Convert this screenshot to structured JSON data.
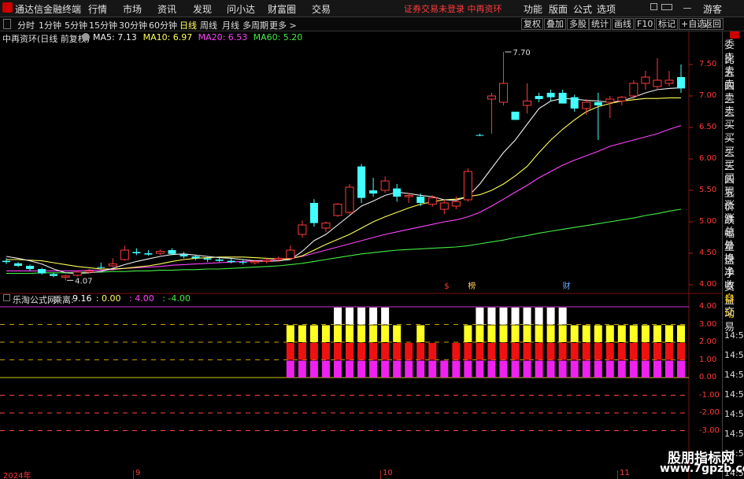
{
  "topbar": {
    "app_title": "通达信金融终端",
    "menu": [
      "行情",
      "市场",
      "资讯",
      "发现",
      "问小达",
      "财富圈",
      "交易"
    ],
    "notice": "证券交易未登录  中再资环",
    "right_menu": [
      "功能",
      "版面",
      "公式",
      "选项"
    ],
    "guest": "游客"
  },
  "timeframes": [
    "分时",
    "1分钟",
    "5分钟",
    "15分钟",
    "30分钟",
    "60分钟",
    "日线",
    "周线",
    "月线",
    "多周期",
    "更多 >"
  ],
  "active_timeframe": "日线",
  "toolbar": [
    "复权",
    "叠加",
    "多股",
    "统计",
    "画线",
    "F10",
    "标记",
    "+自选",
    "返回"
  ],
  "info": {
    "title": "中再资环(日线 前复权)",
    "ma": [
      {
        "label": "MA5: 7.13",
        "color": "#f0f0f0"
      },
      {
        "label": "MA10: 6.97",
        "color": "#ffff55"
      },
      {
        "label": "MA20: 6.53",
        "color": "#ff44ff"
      },
      {
        "label": "MA60: 5.20",
        "color": "#44ee44"
      }
    ]
  },
  "price_axis": [
    "7.50",
    "7.00",
    "6.50",
    "6.00",
    "5.50",
    "5.00",
    "4.50",
    "4.00"
  ],
  "annot": {
    "high": "7.70",
    "low": "4.07"
  },
  "event_labels": [
    "$",
    "榜",
    "财"
  ],
  "indicator": {
    "name": "乐淘公式网",
    "label": "乘离:",
    "values": [
      {
        "v": "9.16",
        "c": "#ffffff"
      },
      {
        "v": ": 0.00",
        "c": "#ffff55"
      },
      {
        "v": ": 4.00",
        "c": "#ff44ff"
      },
      {
        "v": ": -4.00",
        "c": "#44ee44"
      }
    ],
    "axis": [
      "4.00",
      "3.00",
      "2.00",
      "1.00",
      "0.00",
      "-1.00",
      "-2.00",
      "-3.00"
    ]
  },
  "side_tabs": [
    "委比",
    "卖五",
    "卖四",
    "卖三",
    "卖二",
    "卖一",
    "买一",
    "买二",
    "买三",
    "买四",
    "买五",
    "现价",
    "涨跌",
    "涨幅",
    "总量",
    "外盘",
    "换手",
    "净资",
    "收益",
    "自动",
    "交易"
  ],
  "side_times": [
    "14:56",
    "14:56",
    "14:56",
    "14:56",
    "14:56",
    "14:56",
    "14:56",
    "14:56"
  ],
  "dates": [
    "2024年",
    "9",
    "10",
    "11"
  ],
  "watermark": {
    "cn": "股朋指标网",
    "url": "www.7gpzb.com"
  },
  "colors": {
    "up": "#ff3b3b",
    "down": "#44ffff",
    "ma5": "#f0f0f0",
    "ma10": "#ffff55",
    "ma20": "#ff44ff",
    "ma60": "#44ee44"
  },
  "chart_data": {
    "type": "candlestick",
    "candles": [
      [
        4.38,
        4.42,
        4.33,
        4.36
      ],
      [
        4.34,
        4.36,
        4.28,
        4.3
      ],
      [
        4.3,
        4.32,
        4.22,
        4.25
      ],
      [
        4.25,
        4.27,
        4.16,
        4.18
      ],
      [
        4.17,
        4.19,
        4.12,
        4.14
      ],
      [
        4.12,
        4.16,
        4.07,
        4.14
      ],
      [
        4.15,
        4.22,
        4.13,
        4.2
      ],
      [
        4.2,
        4.25,
        4.18,
        4.22
      ],
      [
        4.28,
        4.35,
        4.25,
        4.27
      ],
      [
        4.3,
        4.42,
        4.28,
        4.33
      ],
      [
        4.4,
        4.62,
        4.38,
        4.55
      ],
      [
        4.52,
        4.58,
        4.47,
        4.5
      ],
      [
        4.5,
        4.55,
        4.46,
        4.48
      ],
      [
        4.5,
        4.56,
        4.47,
        4.53
      ],
      [
        4.55,
        4.58,
        4.47,
        4.49
      ],
      [
        4.48,
        4.52,
        4.42,
        4.45
      ],
      [
        4.45,
        4.47,
        4.39,
        4.42
      ],
      [
        4.42,
        4.45,
        4.36,
        4.4
      ],
      [
        4.4,
        4.44,
        4.36,
        4.38
      ],
      [
        4.38,
        4.42,
        4.34,
        4.36
      ],
      [
        4.36,
        4.4,
        4.32,
        4.35
      ],
      [
        4.35,
        4.4,
        4.32,
        4.37
      ],
      [
        4.37,
        4.42,
        4.34,
        4.39
      ],
      [
        4.4,
        4.45,
        4.36,
        4.42
      ],
      [
        4.42,
        4.62,
        4.4,
        4.55
      ],
      [
        4.8,
        5.02,
        4.75,
        4.95
      ],
      [
        5.3,
        5.36,
        4.92,
        4.98
      ],
      [
        4.9,
        5.0,
        4.84,
        4.98
      ],
      [
        5.1,
        5.3,
        5.08,
        5.28
      ],
      [
        5.15,
        5.6,
        5.12,
        5.55
      ],
      [
        5.88,
        5.92,
        5.3,
        5.38
      ],
      [
        5.5,
        5.7,
        5.4,
        5.45
      ],
      [
        5.5,
        5.72,
        5.46,
        5.65
      ],
      [
        5.53,
        5.6,
        5.32,
        5.4
      ],
      [
        5.4,
        5.46,
        5.3,
        5.42
      ],
      [
        5.4,
        5.45,
        5.25,
        5.3
      ],
      [
        5.28,
        5.42,
        5.24,
        5.38
      ],
      [
        5.2,
        5.35,
        5.12,
        5.3
      ],
      [
        5.25,
        5.4,
        5.2,
        5.32
      ],
      [
        5.35,
        5.85,
        5.32,
        5.8
      ],
      [
        6.38,
        6.4,
        6.36,
        6.37
      ],
      [
        6.95,
        7.05,
        6.4,
        7.0
      ],
      [
        6.9,
        7.7,
        6.85,
        7.2
      ],
      [
        6.75,
        6.7,
        6.62,
        6.62
      ],
      [
        6.85,
        7.2,
        6.72,
        6.92
      ],
      [
        7.0,
        7.05,
        6.9,
        6.95
      ],
      [
        7.05,
        7.1,
        6.92,
        6.98
      ],
      [
        7.05,
        7.1,
        6.88,
        6.88
      ],
      [
        6.98,
        7.02,
        6.75,
        6.8
      ],
      [
        6.8,
        6.95,
        6.7,
        6.9
      ],
      [
        6.9,
        7.05,
        6.3,
        6.85
      ],
      [
        6.9,
        7.0,
        6.65,
        6.95
      ],
      [
        6.92,
        7.0,
        6.85,
        6.98
      ],
      [
        7.0,
        7.25,
        6.95,
        7.2
      ],
      [
        7.2,
        7.4,
        7.1,
        7.3
      ],
      [
        7.15,
        7.6,
        7.1,
        7.25
      ],
      [
        7.2,
        7.4,
        7.15,
        7.25
      ],
      [
        7.3,
        7.5,
        7.05,
        7.12
      ]
    ],
    "ma5": [
      4.45,
      4.42,
      4.38,
      4.33,
      4.25,
      4.19,
      4.18,
      4.19,
      4.21,
      4.26,
      4.32,
      4.37,
      4.41,
      4.45,
      4.48,
      4.49,
      4.47,
      4.45,
      4.43,
      4.42,
      4.4,
      4.38,
      4.37,
      4.38,
      4.4,
      4.53,
      4.7,
      4.8,
      4.95,
      5.1,
      5.25,
      5.33,
      5.42,
      5.47,
      5.45,
      5.42,
      5.4,
      5.35,
      5.34,
      5.4,
      5.6,
      5.85,
      6.1,
      6.3,
      6.55,
      6.8,
      6.92,
      6.96,
      6.95,
      6.93,
      6.92,
      6.9,
      6.92,
      6.98,
      7.05,
      7.1,
      7.12,
      7.13
    ],
    "ma10": [
      4.4,
      4.4,
      4.39,
      4.38,
      4.35,
      4.32,
      4.29,
      4.27,
      4.25,
      4.25,
      4.26,
      4.28,
      4.3,
      4.33,
      4.37,
      4.4,
      4.42,
      4.43,
      4.44,
      4.44,
      4.44,
      4.43,
      4.42,
      4.41,
      4.41,
      4.46,
      4.55,
      4.64,
      4.72,
      4.8,
      4.9,
      5.0,
      5.08,
      5.15,
      5.22,
      5.28,
      5.32,
      5.35,
      5.36,
      5.4,
      5.43,
      5.5,
      5.6,
      5.73,
      5.88,
      6.1,
      6.3,
      6.47,
      6.62,
      6.75,
      6.83,
      6.88,
      6.92,
      6.94,
      6.96,
      6.96,
      6.97,
      6.97
    ],
    "ma20": [
      4.22,
      4.22,
      4.22,
      4.22,
      4.22,
      4.22,
      4.22,
      4.23,
      4.23,
      4.24,
      4.26,
      4.27,
      4.28,
      4.29,
      4.31,
      4.32,
      4.33,
      4.34,
      4.35,
      4.36,
      4.37,
      4.38,
      4.39,
      4.4,
      4.42,
      4.45,
      4.5,
      4.55,
      4.6,
      4.65,
      4.7,
      4.75,
      4.8,
      4.84,
      4.88,
      4.92,
      4.96,
      5.0,
      5.03,
      5.08,
      5.15,
      5.25,
      5.36,
      5.47,
      5.58,
      5.7,
      5.8,
      5.9,
      5.98,
      6.05,
      6.12,
      6.2,
      6.25,
      6.3,
      6.35,
      6.4,
      6.47,
      6.53
    ],
    "ma60": [
      4.18,
      4.18,
      4.18,
      4.19,
      4.19,
      4.19,
      4.2,
      4.2,
      4.2,
      4.21,
      4.21,
      4.22,
      4.22,
      4.23,
      4.23,
      4.24,
      4.24,
      4.25,
      4.25,
      4.26,
      4.27,
      4.28,
      4.29,
      4.3,
      4.32,
      4.34,
      4.37,
      4.4,
      4.43,
      4.46,
      4.49,
      4.51,
      4.53,
      4.55,
      4.56,
      4.57,
      4.58,
      4.59,
      4.6,
      4.62,
      4.65,
      4.68,
      4.71,
      4.75,
      4.78,
      4.82,
      4.85,
      4.88,
      4.91,
      4.94,
      4.97,
      5.0,
      5.03,
      5.06,
      5.1,
      5.13,
      5.17,
      5.2
    ],
    "ind_levels": [
      0,
      0,
      0,
      0,
      0,
      0,
      0,
      0,
      0,
      0,
      0,
      0,
      0,
      0,
      0,
      0,
      0,
      0,
      0,
      0,
      0,
      0,
      0,
      0,
      3,
      3,
      3,
      3,
      4,
      4,
      4,
      4,
      4,
      3,
      2,
      3,
      2,
      1,
      2,
      3,
      4,
      4,
      4,
      4,
      4,
      4,
      4,
      4,
      3,
      3,
      3,
      3,
      3,
      3,
      3,
      3,
      3,
      3
    ],
    "ind_ylim": [
      -4,
      4
    ],
    "ylim": [
      3.9,
      7.8
    ]
  }
}
